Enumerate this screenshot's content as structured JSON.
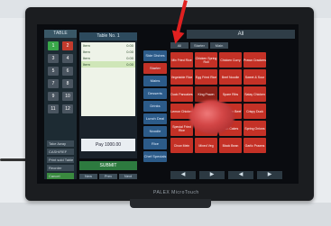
{
  "screen": {
    "table_panel": {
      "title": "TABLE",
      "buttons": [
        "1",
        "2",
        "3",
        "4",
        "5",
        "6",
        "7",
        "8",
        "9",
        "10",
        "11",
        "12"
      ],
      "side_buttons": [
        "Take Away",
        "CASH/REF",
        "Print sold Table",
        "Reorder Waiting"
      ],
      "cancel": "Cancel"
    },
    "ticket": {
      "title": "Table No. 1",
      "lines": [
        {
          "name": "Item",
          "qty": "1",
          "price": "0.00"
        },
        {
          "name": "Item",
          "qty": "1",
          "price": "0.00"
        },
        {
          "name": "Item",
          "qty": "1",
          "price": "0.00"
        },
        {
          "name": "Item",
          "qty": "1",
          "price": "0.00"
        }
      ],
      "pay_label": "Pay 1000.00",
      "submit": "SUBMIT",
      "bottom": [
        "New",
        "Prev",
        "Next"
      ]
    },
    "categories": [
      "Side Dishes",
      "Starter",
      "Mains",
      "Desserts",
      "Drinks",
      "Lunch Deal",
      "Noodle",
      "Rice",
      "Chef Specials"
    ],
    "all_header": "All",
    "tabs": [
      "All",
      "Starter",
      "Main"
    ],
    "items": [
      "Mix Fried Rice",
      "Chicken Spring Roll",
      "Chicken Curry",
      "Prawn Crackers",
      "Vegetable Rice",
      "Egg Fried Rice",
      "Beef Noodle",
      "Sweet & Sour",
      "Duck Pancakes",
      "King Prawn",
      "Spare Ribs",
      "Satay Chicken",
      "Lemon Chicken",
      "Boiled Rice",
      "Szechuan Beef",
      "Crispy Duck",
      "Special Fried Rice",
      "Salt Pepper Ribs",
      "Fish Cakes",
      "Spring Onions",
      "Chow Mein",
      "Mixed Veg",
      "Black Bean",
      "Garlic Prawns"
    ],
    "nav": [
      "◀",
      "▶",
      "◀",
      "▶"
    ],
    "brand": "PALEX MicroTouch"
  },
  "colors": {
    "item": "#c43126",
    "category": "#2c5b89",
    "arrow": "#e02020"
  }
}
